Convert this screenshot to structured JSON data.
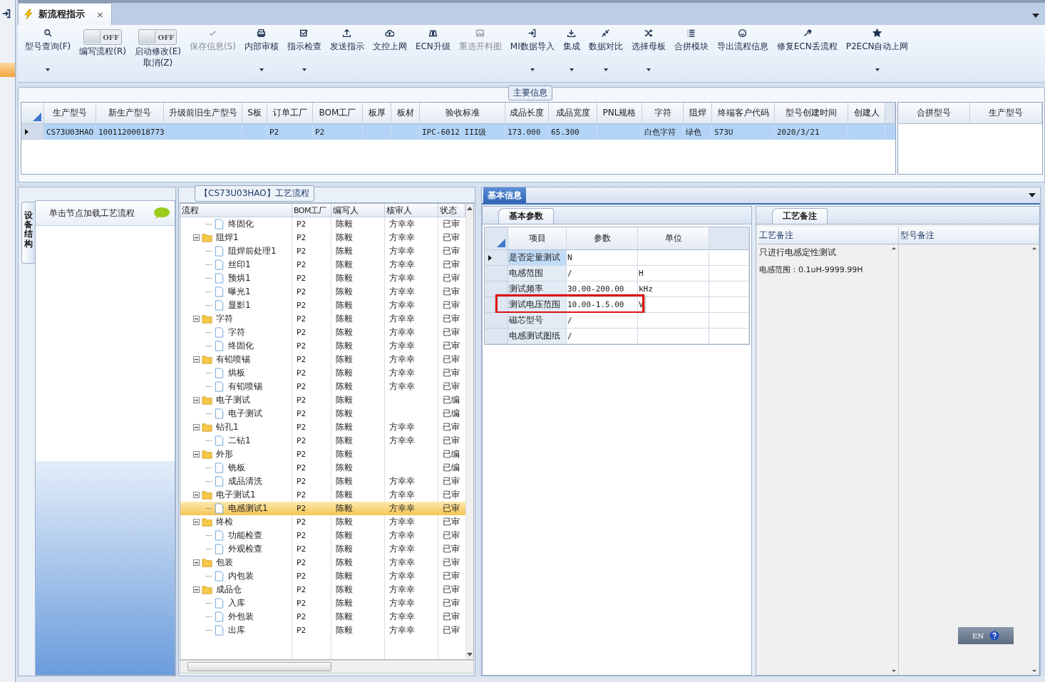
{
  "document_tab": {
    "title": "新流程指示",
    "close": "×",
    "selected": true
  },
  "toolbar": [
    {
      "kind": "button",
      "label": "型号查询(F)",
      "dropdown": true,
      "disabled": false
    },
    {
      "kind": "toggle",
      "switch_text": "OFF",
      "on": false,
      "label": "编写流程(R)",
      "dropdown": false,
      "disabled": false
    },
    {
      "kind": "toggle",
      "switch_text": "OFF",
      "on": false,
      "label": "启动修改(E)\n取消(Z)",
      "dropdown": false,
      "disabled": false
    },
    {
      "kind": "button",
      "label": "保存信息(S)",
      "dropdown": false,
      "disabled": true
    },
    {
      "kind": "button",
      "label": "内部审核",
      "dropdown": true,
      "disabled": false
    },
    {
      "kind": "button",
      "label": "指示检查",
      "dropdown": true,
      "disabled": false
    },
    {
      "kind": "button",
      "label": "发送指示",
      "dropdown": false,
      "disabled": false
    },
    {
      "kind": "button",
      "label": "文控上网",
      "dropdown": false,
      "disabled": false
    },
    {
      "kind": "button",
      "label": "ECN升级",
      "dropdown": false,
      "disabled": false
    },
    {
      "kind": "button",
      "label": "重选开料图",
      "dropdown": false,
      "disabled": true
    },
    {
      "kind": "button",
      "label": "MI数据导入",
      "dropdown": true,
      "disabled": false
    },
    {
      "kind": "button",
      "label": "集成",
      "dropdown": true,
      "disabled": false
    },
    {
      "kind": "button",
      "label": "数据对比",
      "dropdown": true,
      "disabled": false
    },
    {
      "kind": "button",
      "label": "选择母板",
      "dropdown": true,
      "disabled": false
    },
    {
      "kind": "button",
      "label": "合拼模块",
      "dropdown": false,
      "disabled": false
    },
    {
      "kind": "button",
      "label": "导出流程信息",
      "dropdown": false,
      "disabled": false
    },
    {
      "kind": "button",
      "label": "修复ECN丢流程",
      "dropdown": false,
      "disabled": false
    },
    {
      "kind": "button",
      "label": "P2ECN自动上网",
      "dropdown": true,
      "disabled": false
    }
  ],
  "main_info": {
    "title": "主要信息",
    "table": {
      "columns": [
        "生产型号",
        "新生产型号",
        "升级前旧生产型号",
        "S板",
        "订单工厂",
        "BOM工厂",
        "板厚",
        "板材",
        "验收标准",
        "成品长度",
        "成品宽度",
        "PNL规格",
        "字符",
        "阻焊",
        "终端客户代码",
        "型号创建时间",
        "创建人"
      ],
      "rows": [
        {
          "selected": true,
          "cells": [
            "CS73U03HAO",
            "10011200018773",
            null,
            null,
            "P2",
            "P2",
            null,
            null,
            "IPC-6012 III级",
            "173.000",
            "65.300",
            null,
            "白色字符",
            "绿色",
            "S73U",
            "2020/3/21",
            null
          ]
        }
      ]
    },
    "merge_table": {
      "columns": [
        "合拼型号",
        "生产型号"
      ]
    }
  },
  "side_panel": {
    "vertical_tab": "设备结构",
    "hint": "单击节点加载工艺流程"
  },
  "process_tree": {
    "title": "【CS73U03HAO】工艺流程",
    "columns": [
      "流程",
      "BOM工厂",
      "编写人",
      "核审人",
      "状态"
    ],
    "nodes": [
      {
        "name": "终固化",
        "factory": "P2",
        "writer": "陈毅",
        "reviewer": "方幸幸",
        "status": "已审",
        "selected": false
      },
      {
        "name": "阻焊1",
        "factory": "P2",
        "writer": "陈毅",
        "reviewer": "方幸幸",
        "status": "已审",
        "selected": false,
        "expanded": true,
        "children": [
          {
            "name": "阻焊前处理1",
            "factory": "P2",
            "writer": "陈毅",
            "reviewer": "方幸幸",
            "status": "已审",
            "selected": false
          },
          {
            "name": "丝印1",
            "factory": "P2",
            "writer": "陈毅",
            "reviewer": "方幸幸",
            "status": "已审",
            "selected": false
          },
          {
            "name": "预烘1",
            "factory": "P2",
            "writer": "陈毅",
            "reviewer": "方幸幸",
            "status": "已审",
            "selected": false
          },
          {
            "name": "曝光1",
            "factory": "P2",
            "writer": "陈毅",
            "reviewer": "方幸幸",
            "status": "已审",
            "selected": false
          },
          {
            "name": "显影1",
            "factory": "P2",
            "writer": "陈毅",
            "reviewer": "方幸幸",
            "status": "已审",
            "selected": false
          }
        ]
      },
      {
        "name": "字符",
        "factory": "P2",
        "writer": "陈毅",
        "reviewer": "方幸幸",
        "status": "已审",
        "selected": false,
        "expanded": true,
        "children": [
          {
            "name": "字符",
            "factory": "P2",
            "writer": "陈毅",
            "reviewer": "方幸幸",
            "status": "已审",
            "selected": false
          },
          {
            "name": "终固化",
            "factory": "P2",
            "writer": "陈毅",
            "reviewer": "方幸幸",
            "status": "已审",
            "selected": false
          }
        ]
      },
      {
        "name": "有铅喷锡",
        "factory": "P2",
        "writer": "陈毅",
        "reviewer": "方幸幸",
        "status": "已审",
        "selected": false,
        "expanded": true,
        "children": [
          {
            "name": "烘板",
            "factory": "P2",
            "writer": "陈毅",
            "reviewer": "方幸幸",
            "status": "已审",
            "selected": false
          },
          {
            "name": "有铅喷锡",
            "factory": "P2",
            "writer": "陈毅",
            "reviewer": "方幸幸",
            "status": "已审",
            "selected": false
          }
        ]
      },
      {
        "name": "电子测试",
        "factory": "P2",
        "writer": "陈毅",
        "status": "已编",
        "selected": false,
        "expanded": true,
        "children": [
          {
            "name": "电子测试",
            "factory": "P2",
            "writer": "陈毅",
            "status": "已编",
            "selected": false
          }
        ]
      },
      {
        "name": "钻孔1",
        "factory": "P2",
        "writer": "陈毅",
        "reviewer": "方幸幸",
        "status": "已审",
        "selected": false,
        "expanded": true,
        "children": [
          {
            "name": "二钻1",
            "factory": "P2",
            "writer": "陈毅",
            "reviewer": "方幸幸",
            "status": "已审",
            "selected": false
          }
        ]
      },
      {
        "name": "外形",
        "factory": "P2",
        "writer": "陈毅",
        "status": "已编",
        "selected": false,
        "expanded": true,
        "children": [
          {
            "name": "铣板",
            "factory": "P2",
            "writer": "陈毅",
            "status": "已编",
            "selected": false
          },
          {
            "name": "成品清洗",
            "factory": "P2",
            "writer": "陈毅",
            "reviewer": "方幸幸",
            "status": "已审",
            "selected": false
          }
        ]
      },
      {
        "name": "电子测试1",
        "factory": "P2",
        "writer": "陈毅",
        "reviewer": "方幸幸",
        "status": "已审",
        "selected": false,
        "expanded": true,
        "children": [
          {
            "name": "电感测试1",
            "factory": "P2",
            "writer": "陈毅",
            "reviewer": "方幸幸",
            "status": "已审",
            "selected": true
          }
        ]
      },
      {
        "name": "终检",
        "factory": "P2",
        "writer": "陈毅",
        "reviewer": "方幸幸",
        "status": "已审",
        "selected": false,
        "expanded": true,
        "children": [
          {
            "name": "功能检查",
            "factory": "P2",
            "writer": "陈毅",
            "reviewer": "方幸幸",
            "status": "已审",
            "selected": false
          },
          {
            "name": "外观检查",
            "factory": "P2",
            "writer": "陈毅",
            "reviewer": "方幸幸",
            "status": "已审",
            "selected": false
          }
        ]
      },
      {
        "name": "包装",
        "factory": "P2",
        "writer": "陈毅",
        "reviewer": "方幸幸",
        "status": "已审",
        "selected": false,
        "expanded": true,
        "children": [
          {
            "name": "内包装",
            "factory": "P2",
            "writer": "陈毅",
            "reviewer": "方幸幸",
            "status": "已审",
            "selected": false
          }
        ]
      },
      {
        "name": "成品仓",
        "factory": "P2",
        "writer": "陈毅",
        "reviewer": "方幸幸",
        "status": "已审",
        "selected": false,
        "expanded": true,
        "children": [
          {
            "name": "入库",
            "factory": "P2",
            "writer": "陈毅",
            "reviewer": "方幸幸",
            "status": "已审",
            "selected": false
          },
          {
            "name": "外包装",
            "factory": "P2",
            "writer": "陈毅",
            "reviewer": "方幸幸",
            "status": "已审",
            "selected": false
          },
          {
            "name": "出库",
            "factory": "P2",
            "writer": "陈毅",
            "reviewer": "方幸幸",
            "status": "已审",
            "selected": false
          }
        ]
      }
    ]
  },
  "info_panel": {
    "title": "基本信息",
    "params": {
      "tab": "基本参数",
      "columns": [
        "项目",
        "参数",
        "单位"
      ],
      "rows": [
        {
          "item": "是否定量测试",
          "value": "N",
          "selected": true,
          "highlighted": false
        },
        {
          "item": "电感范围",
          "value": "/",
          "unit": "H",
          "selected": false,
          "highlighted": false
        },
        {
          "item": "测试频率",
          "value": "30.00-200.00",
          "unit": "kHz",
          "selected": false,
          "highlighted": false
        },
        {
          "item": "测试电压范围",
          "value": "10.00-1.5.00",
          "unit": "V",
          "selected": false,
          "highlighted": true
        },
        {
          "item": "磁芯型号",
          "value": "/",
          "selected": false,
          "highlighted": false
        },
        {
          "item": "电感测试图纸",
          "value": "/",
          "selected": false,
          "highlighted": false
        }
      ]
    },
    "remarks": {
      "tab": "工艺备注",
      "columns": [
        "工艺备注",
        "型号备注"
      ],
      "process_remark": [
        "只进行电感定性测试",
        "电感范围：0.1uH-9999.99H"
      ]
    }
  },
  "ime": {
    "lang": "EN"
  }
}
